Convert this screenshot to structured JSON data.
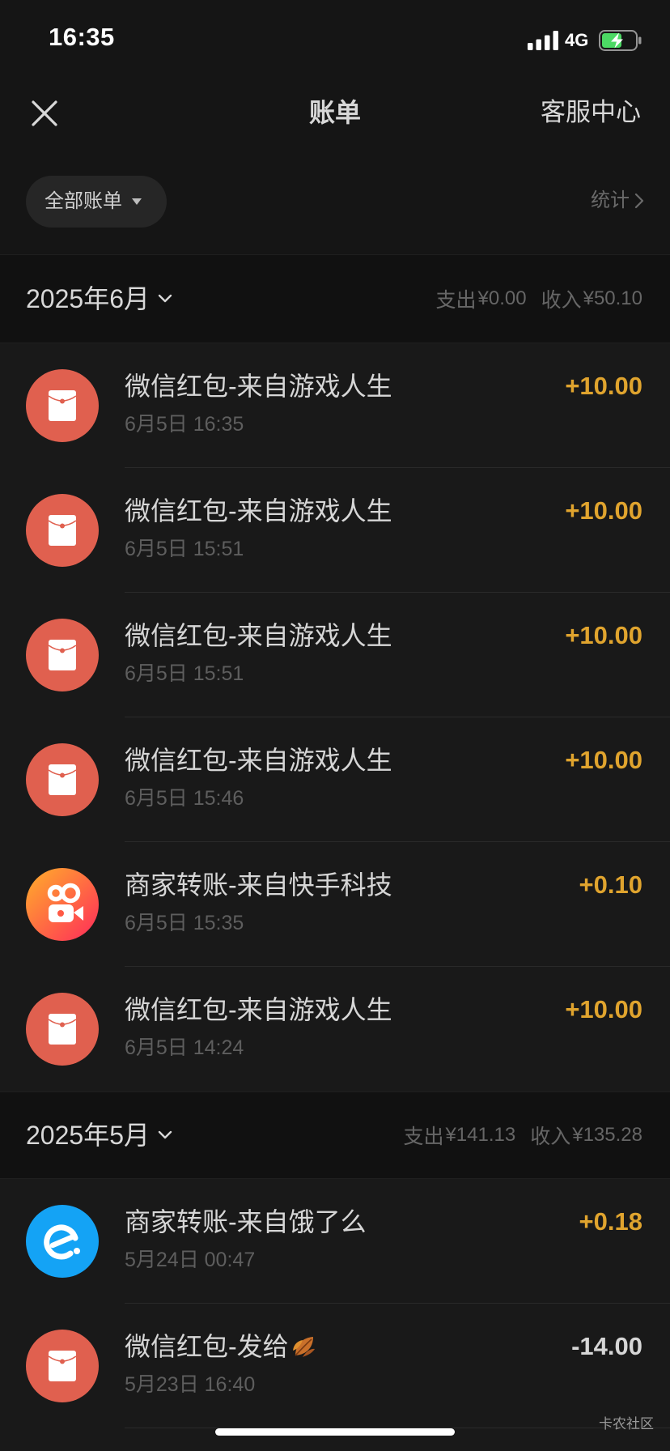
{
  "status_bar": {
    "time": "16:35",
    "network": "4G",
    "signal_icon": "signal-bars-icon",
    "battery": {
      "icon": "battery-charging-icon",
      "level": 0.6,
      "charging": true
    }
  },
  "header": {
    "close_icon": "close-icon",
    "title": "账单",
    "service_label": "客服中心"
  },
  "filter": {
    "label": "全部账单",
    "dropdown_icon": "triangle-down-icon",
    "stats_label": "统计",
    "stats_icon": "chevron-right-icon"
  },
  "months": [
    {
      "label": "2025年6月",
      "toggle_icon": "chevron-down-icon",
      "expense_label": "支出",
      "expense": "¥0.00",
      "income_label": "收入",
      "income": "¥50.10",
      "transactions": [
        {
          "icon": "red-packet-icon",
          "title": "微信红包-来自游戏人生",
          "time": "6月5日 16:35",
          "amount": "+10.00",
          "type": "income"
        },
        {
          "icon": "red-packet-icon",
          "title": "微信红包-来自游戏人生",
          "time": "6月5日 15:51",
          "amount": "+10.00",
          "type": "income"
        },
        {
          "icon": "red-packet-icon",
          "title": "微信红包-来自游戏人生",
          "time": "6月5日 15:51",
          "amount": "+10.00",
          "type": "income"
        },
        {
          "icon": "red-packet-icon",
          "title": "微信红包-来自游戏人生",
          "time": "6月5日 15:46",
          "amount": "+10.00",
          "type": "income"
        },
        {
          "icon": "kuaishou-logo-icon",
          "title": "商家转账-来自快手科技",
          "time": "6月5日 15:35",
          "amount": "+0.10",
          "type": "income"
        },
        {
          "icon": "red-packet-icon",
          "title": "微信红包-来自游戏人生",
          "time": "6月5日 14:24",
          "amount": "+10.00",
          "type": "income"
        }
      ]
    },
    {
      "label": "2025年5月",
      "toggle_icon": "chevron-down-icon",
      "expense_label": "支出",
      "expense": "¥141.13",
      "income_label": "收入",
      "income": "¥135.28",
      "transactions": [
        {
          "icon": "eleme-logo-icon",
          "title": "商家转账-来自饿了么",
          "time": "5月24日 00:47",
          "amount": "+0.18",
          "type": "income"
        },
        {
          "icon": "red-packet-icon",
          "title": "微信红包-发给",
          "title_suffix_icon": "fallen-leaf-icon",
          "time": "5月23日 16:40",
          "amount": "-14.00",
          "type": "expense"
        }
      ]
    }
  ],
  "watermark": "卡农社区",
  "colors": {
    "top_bg": "#151515",
    "band_bg": "#111111",
    "row_bg": "#191919",
    "income": "#e0a42e",
    "expense": "#d6d6d6",
    "red_packet": "#e0604f",
    "battery_fill": "#4cd964",
    "eleme_blue": "#14a3f5"
  }
}
